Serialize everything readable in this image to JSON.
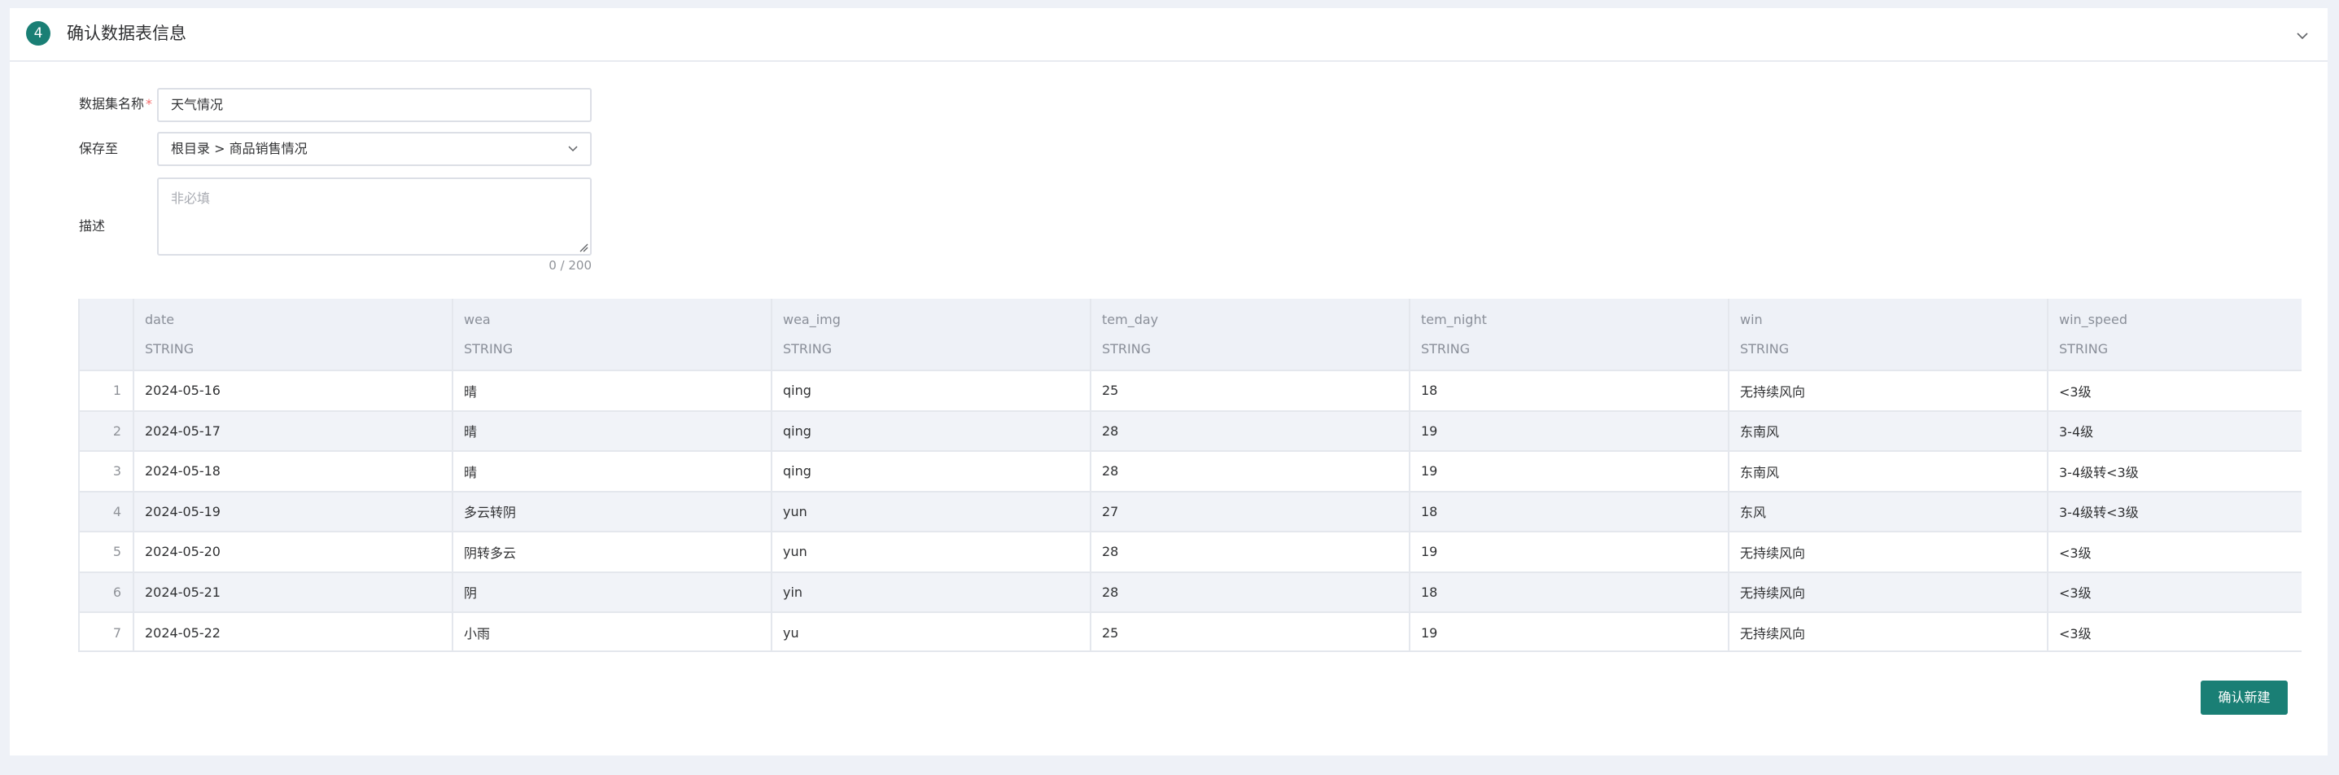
{
  "header": {
    "step_number": "4",
    "title": "确认数据表信息"
  },
  "form": {
    "name_label": "数据集名称",
    "name_required_mark": "*",
    "name_value": "天气情况",
    "save_to_label": "保存至",
    "save_to_value": "根目录 > 商品销售情况",
    "description_label": "描述",
    "description_placeholder": "非必填",
    "description_count": "0 / 200"
  },
  "table": {
    "columns": [
      {
        "name": "date",
        "type": "STRING"
      },
      {
        "name": "wea",
        "type": "STRING"
      },
      {
        "name": "wea_img",
        "type": "STRING"
      },
      {
        "name": "tem_day",
        "type": "STRING"
      },
      {
        "name": "tem_night",
        "type": "STRING"
      },
      {
        "name": "win",
        "type": "STRING"
      },
      {
        "name": "win_speed",
        "type": "STRING"
      }
    ],
    "rows": [
      {
        "index": "1",
        "cells": [
          "2024-05-16",
          "晴",
          "qing",
          "25",
          "18",
          "无持续风向",
          "<3级"
        ]
      },
      {
        "index": "2",
        "cells": [
          "2024-05-17",
          "晴",
          "qing",
          "28",
          "19",
          "东南风",
          "3-4级"
        ]
      },
      {
        "index": "3",
        "cells": [
          "2024-05-18",
          "晴",
          "qing",
          "28",
          "19",
          "东南风",
          "3-4级转<3级"
        ]
      },
      {
        "index": "4",
        "cells": [
          "2024-05-19",
          "多云转阴",
          "yun",
          "27",
          "18",
          "东风",
          "3-4级转<3级"
        ]
      },
      {
        "index": "5",
        "cells": [
          "2024-05-20",
          "阴转多云",
          "yun",
          "28",
          "19",
          "无持续风向",
          "<3级"
        ]
      },
      {
        "index": "6",
        "cells": [
          "2024-05-21",
          "阴",
          "yin",
          "28",
          "18",
          "无持续风向",
          "<3级"
        ]
      },
      {
        "index": "7",
        "cells": [
          "2024-05-22",
          "小雨",
          "yu",
          "25",
          "19",
          "无持续风向",
          "<3级"
        ]
      }
    ]
  },
  "actions": {
    "confirm_label": "确认新建"
  },
  "colors": {
    "accent": "#1a7f75",
    "page_bg": "#eef1f7",
    "required": "#f56c6c"
  },
  "icons": {
    "collapse": "chevron-down-icon",
    "select": "chevron-down-icon"
  }
}
